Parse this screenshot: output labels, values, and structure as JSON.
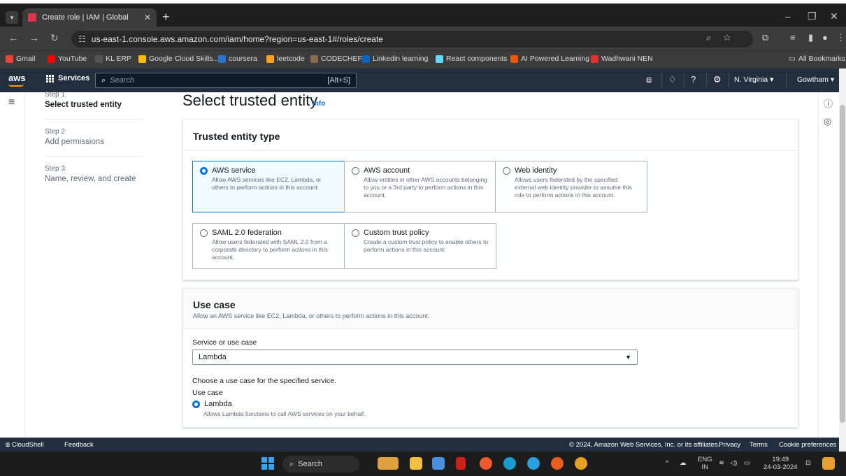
{
  "browser": {
    "tab_title": "Create role | IAM | Global",
    "url": "us-east-1.console.aws.amazon.com/iam/home?region=us-east-1#/roles/create",
    "bookmarks": [
      "Gmail",
      "YouTube",
      "KL ERP",
      "Google Cloud Skills...",
      "coursera",
      "leetcode",
      "CODECHEF",
      "Linkedin learning",
      "React components",
      "AI Powered Learning",
      "Wadhwani NEN"
    ],
    "all_bookmarks": "All Bookmarks"
  },
  "aws_header": {
    "logo": "aws",
    "services": "Services",
    "search_placeholder": "Search",
    "shortcut": "[Alt+S]",
    "region": "N. Virginia ▾",
    "user": "Gowtham ▾"
  },
  "steps": [
    {
      "num": "Step 1",
      "label": "Select trusted entity"
    },
    {
      "num": "Step 2",
      "label": "Add permissions"
    },
    {
      "num": "Step 3",
      "label": "Name, review, and create"
    }
  ],
  "page_title": "Select trusted entity",
  "info_link": "Info",
  "trusted_entity": {
    "heading": "Trusted entity type",
    "options": [
      {
        "title": "AWS service",
        "desc": "Allow AWS services like EC2, Lambda, or others to perform actions in this account."
      },
      {
        "title": "AWS account",
        "desc": "Allow entities in other AWS accounts belonging to you or a 3rd party to perform actions in this account."
      },
      {
        "title": "Web identity",
        "desc": "Allows users federated by the specified external web identity provider to assume this role to perform actions in this account."
      },
      {
        "title": "SAML 2.0 federation",
        "desc": "Allow users federated with SAML 2.0 from a corporate directory to perform actions in this account."
      },
      {
        "title": "Custom trust policy",
        "desc": "Create a custom trust policy to enable others to perform actions in this account."
      }
    ]
  },
  "use_case": {
    "heading": "Use case",
    "subtitle": "Allow an AWS service like EC2, Lambda, or others to perform actions in this account.",
    "service_label": "Service or use case",
    "service_value": "Lambda",
    "choose_text": "Choose a use case for the specified service.",
    "use_case_label": "Use case",
    "option_title": "Lambda",
    "option_desc": "Allows Lambda functions to call AWS services on your behalf."
  },
  "footer": {
    "cloudshell": "CloudShell",
    "feedback": "Feedback",
    "copyright": "© 2024, Amazon Web Services, Inc. or its affiliates.",
    "privacy": "Privacy",
    "terms": "Terms",
    "cookies": "Cookie preferences"
  },
  "taskbar": {
    "search": "Search",
    "lang_top": "ENG",
    "lang_bottom": "IN",
    "time": "19:49",
    "date": "24-03-2024"
  }
}
